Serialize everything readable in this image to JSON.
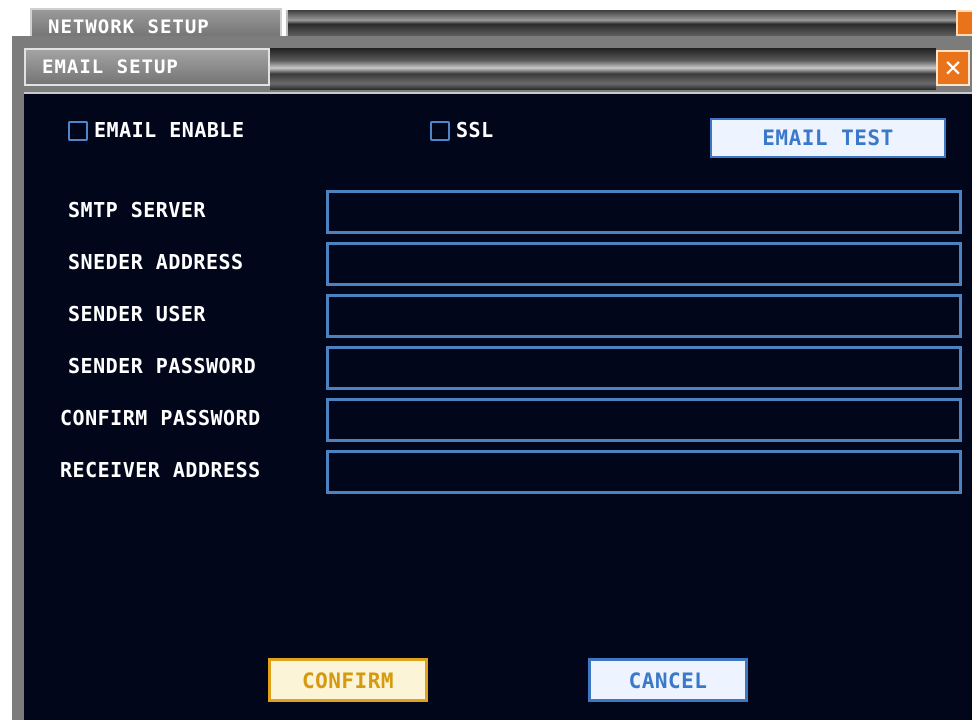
{
  "back_window": {
    "title": "NETWORK SETUP"
  },
  "window": {
    "title": "EMAIL SETUP",
    "close_symbol": "✕"
  },
  "options": {
    "email_enable": {
      "label": "EMAIL ENABLE",
      "checked": false
    },
    "ssl": {
      "label": "SSL",
      "checked": false
    },
    "email_test_label": "EMAIL TEST"
  },
  "fields": {
    "smtp_server": {
      "label": "SMTP SERVER",
      "value": ""
    },
    "sender_address": {
      "label": "SNEDER ADDRESS",
      "value": ""
    },
    "sender_user": {
      "label": "SENDER USER",
      "value": ""
    },
    "sender_password": {
      "label": "SENDER PASSWORD",
      "value": ""
    },
    "confirm_password": {
      "label": "CONFIRM PASSWORD",
      "value": ""
    },
    "receiver_address": {
      "label": "RECEIVER ADDRESS",
      "value": ""
    }
  },
  "actions": {
    "confirm_label": "CONFIRM",
    "cancel_label": "CANCEL"
  },
  "colors": {
    "panel_background": "#01061a",
    "field_border": "#4d82c0",
    "confirm_accent": "#e0a21a",
    "close_button": "#e8731a"
  }
}
